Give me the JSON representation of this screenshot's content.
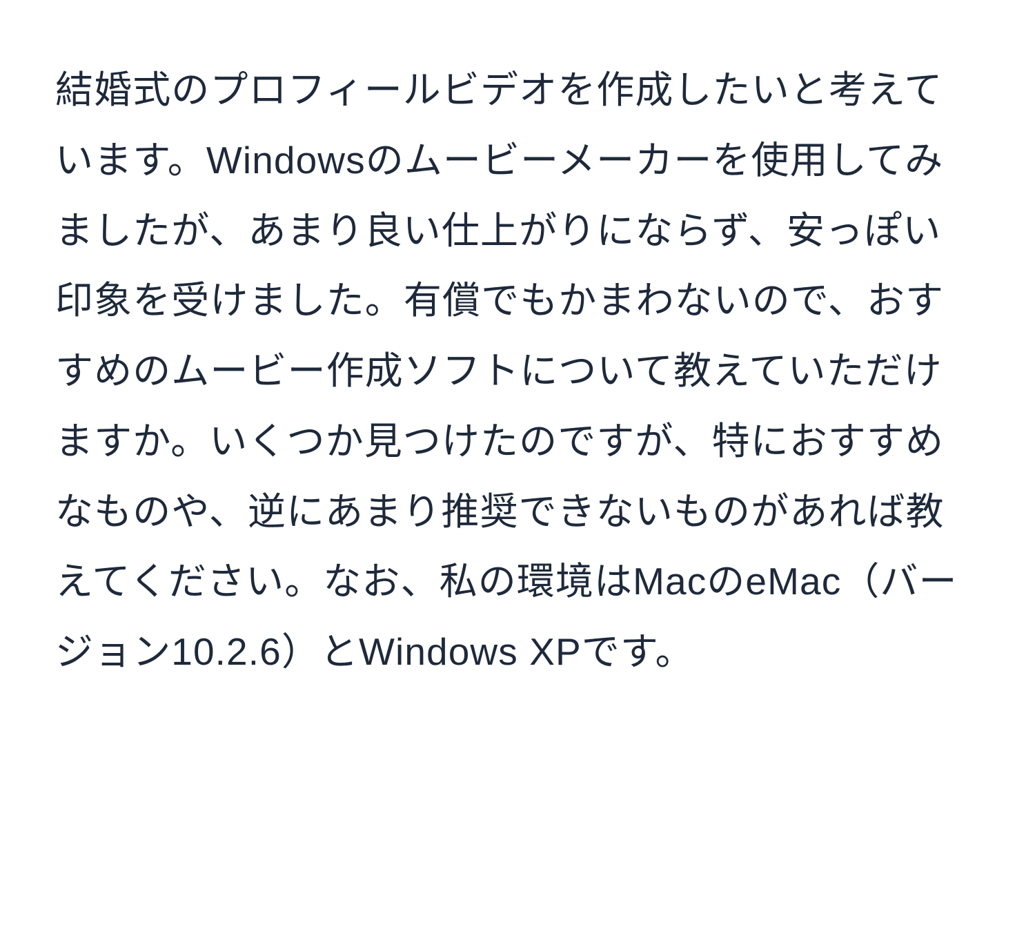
{
  "document": {
    "body_text": "結婚式のプロフィールビデオを作成したいと考えています。Windowsのムービーメーカーを使用してみましたが、あまり良い仕上がりにならず、安っぽい印象を受けました。有償でもかまわないので、おすすめのムービー作成ソフトについて教えていただけますか。いくつか見つけたのですが、特におすすめなものや、逆にあまり推奨できないものがあれば教えてください。なお、私の環境はMacのeMac（バージョン10.2.6）とWindows XPです。"
  }
}
